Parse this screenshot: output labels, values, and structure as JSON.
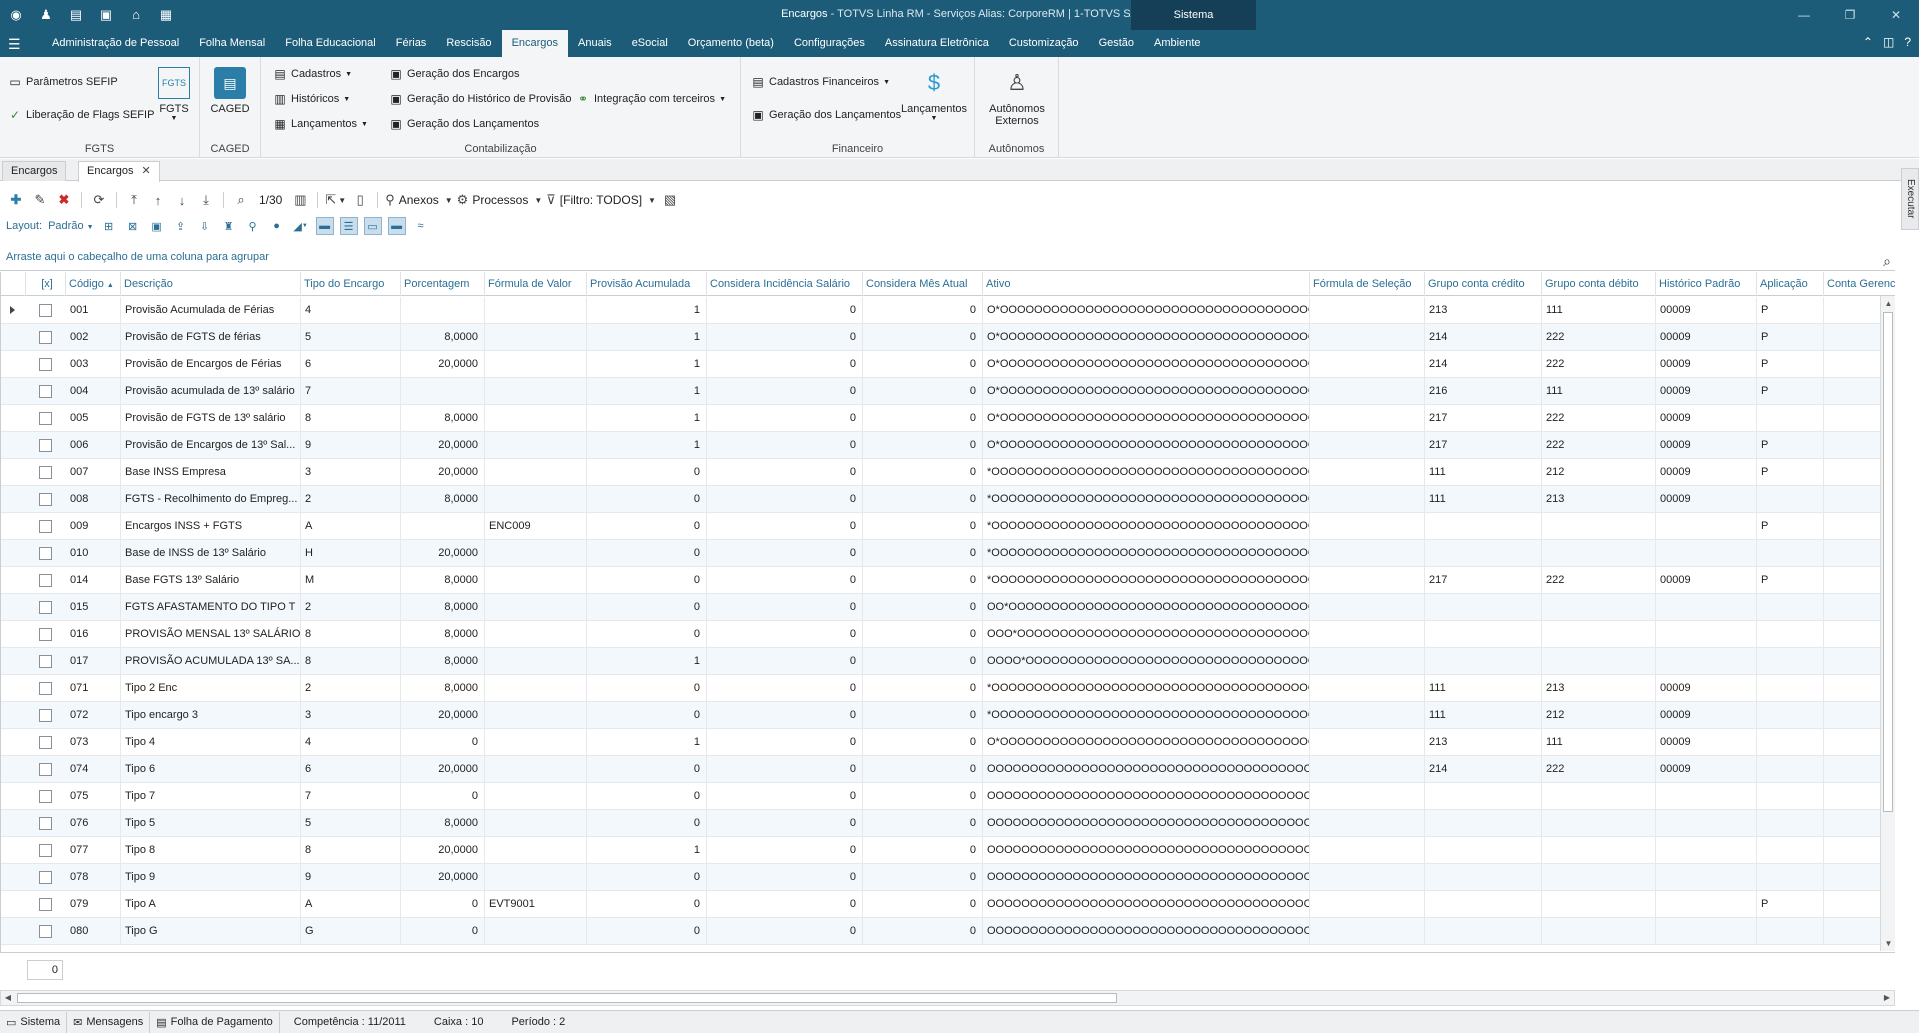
{
  "window": {
    "title_app": "Encargos",
    "title_rest": " - TOTVS Linha RM - Serviços  Alias: CorporeRM | 1-TOTVS SA",
    "context_tab": "Sistema",
    "controls": [
      "—",
      "❐",
      "✕"
    ]
  },
  "menu": {
    "items": [
      "Administração de Pessoal",
      "Folha Mensal",
      "Folha Educacional",
      "Férias",
      "Rescisão",
      "Encargos",
      "Anuais",
      "eSocial",
      "Orçamento (beta)",
      "Configurações",
      "Assinatura Eletrônica",
      "Customização",
      "Gestão",
      "Ambiente"
    ],
    "active": "Encargos"
  },
  "ribbon": {
    "fgts": {
      "label": "FGTS",
      "parametros": "Parâmetros SEFIP",
      "liberacao": "Liberação de Flags SEFIP",
      "fgts_btn": "FGTS",
      "fgts_icon_text": "FGTS"
    },
    "caged": {
      "label": "CAGED",
      "btn": "CAGED"
    },
    "contabilizacao": {
      "label": "Contabilização",
      "cadastros": "Cadastros",
      "historicos": "Históricos",
      "lancamentos": "Lançamentos",
      "geracao_encargos": "Geração dos Encargos",
      "geracao_historico": "Geração do Histórico de Provisão",
      "geracao_lancamentos": "Geração dos Lançamentos",
      "integracao": "Integração com terceiros"
    },
    "financeiro": {
      "label": "Financeiro",
      "cadastros_fin": "Cadastros Financeiros",
      "geracao_lanc": "Geração dos Lançamentos",
      "lancamentos": "Lançamentos"
    },
    "autonomos": {
      "label": "Autônomos",
      "btn_line1": "Autônomos",
      "btn_line2": "Externos"
    }
  },
  "doc_tabs": [
    "Encargos",
    "Encargos"
  ],
  "side_tab": "Executar",
  "toolbar": {
    "pager": "1/30",
    "anexos": "Anexos",
    "processos": "Processos",
    "filtro": "[Filtro: TODOS]"
  },
  "layoutbar": {
    "label": "Layout:",
    "value": "Padrão"
  },
  "group_hint": "Arraste aqui o cabeçalho de uma coluna para agrupar",
  "columns": [
    "[x]",
    "Código",
    "Descrição",
    "Tipo do Encargo",
    "Porcentagem",
    "Fórmula de Valor",
    "Provisão Acumulada",
    "Considera Incidência Salário",
    "Considera Mês Atual",
    "Ativo",
    "Fórmula de Seleção",
    "Grupo conta crédito",
    "Grupo conta débito",
    "Histórico Padrão",
    "Aplicação",
    "Conta Gerenci"
  ],
  "rows": [
    [
      "001",
      "Provisão Acumulada de Férias",
      "4",
      "",
      "",
      "1",
      "0",
      "0",
      "O*OOOOOOOOOOOOOOOOOOOOOOOOOOOOOOOOOOOOOO...",
      "",
      "213",
      "111",
      "00009",
      "P"
    ],
    [
      "002",
      "Provisão de FGTS de férias",
      "5",
      "8,0000",
      "",
      "1",
      "0",
      "0",
      "O*OOOOOOOOOOOOOOOOOOOOOOOOOOOOOOOOOOOOOO...",
      "",
      "214",
      "222",
      "00009",
      "P"
    ],
    [
      "003",
      "Provisão de Encargos de Férias",
      "6",
      "20,0000",
      "",
      "1",
      "0",
      "0",
      "O*OOOOOOOOOOOOOOOOOOOOOOOOOOOOOOOOOOOOOO...",
      "",
      "214",
      "222",
      "00009",
      "P"
    ],
    [
      "004",
      "Provisão acumulada de 13º salário",
      "7",
      "",
      "",
      "1",
      "0",
      "0",
      "O*OOOOOOOOOOOOOOOOOOOOOOOOOOOOOOOOOOOOOO...",
      "",
      "216",
      "111",
      "00009",
      "P"
    ],
    [
      "005",
      "Provisão de FGTS de 13º salário",
      "8",
      "8,0000",
      "",
      "1",
      "0",
      "0",
      "O*OOOOOOOOOOOOOOOOOOOOOOOOOOOOOOOOOOOOOO...",
      "",
      "217",
      "222",
      "00009",
      ""
    ],
    [
      "006",
      "Provisão de Encargos de 13º Sal...",
      "9",
      "20,0000",
      "",
      "1",
      "0",
      "0",
      "O*OOOOOOOOOOOOOOOOOOOOOOOOOOOOOOOOOOOOOO...",
      "",
      "217",
      "222",
      "00009",
      "P"
    ],
    [
      "007",
      "Base INSS Empresa",
      "3",
      "20,0000",
      "",
      "0",
      "0",
      "0",
      "*OOOOOOOOOOOOOOOOOOOOOOOOOOOOOOOOOOOOOOO...",
      "",
      "111",
      "212",
      "00009",
      "P"
    ],
    [
      "008",
      "FGTS - Recolhimento do Empreg...",
      "2",
      "8,0000",
      "",
      "0",
      "0",
      "0",
      "*OOOOOOOOOOOOOOOOOOOOOOOOOOOOOOOOOOOOOOO...",
      "",
      "111",
      "213",
      "00009",
      ""
    ],
    [
      "009",
      "Encargos  INSS + FGTS",
      "A",
      "",
      "ENC009",
      "0",
      "0",
      "0",
      "*OOOOOOOOOOOOOOOOOOOOOOOOOOOOOOOOOOOOOOO...",
      "",
      "",
      "",
      "",
      "P"
    ],
    [
      "010",
      "Base de INSS de 13º Salário",
      "H",
      "20,0000",
      "",
      "0",
      "0",
      "0",
      "*OOOOOOOOOOOOOOOOOOOOOOOOOOOOOOOOOOOOOOO...",
      "",
      "",
      "",
      "",
      ""
    ],
    [
      "014",
      "Base FGTS 13º Salário",
      "M",
      "8,0000",
      "",
      "0",
      "0",
      "0",
      "*OOOOOOOOOOOOOOOOOOOOOOOOOOOOOOOOOOOOOOO...",
      "",
      "217",
      "222",
      "00009",
      "P"
    ],
    [
      "015",
      "FGTS AFASTAMENTO DO TIPO T",
      "2",
      "8,0000",
      "",
      "0",
      "0",
      "0",
      "OO*OOOOOOOOOOOOOOOOOOOOOOOOOOOOOOOOOOOOO...",
      "",
      "",
      "",
      "",
      ""
    ],
    [
      "016",
      "PROVISÃO MENSAL 13º SALÁRIO",
      "8",
      "8,0000",
      "",
      "0",
      "0",
      "0",
      "OOO*OOOOOOOOOOOOOOOOOOOOOOOOOOOOOOOOOOOO...",
      "",
      "",
      "",
      "",
      ""
    ],
    [
      "017",
      "PROVISÃO ACUMULADA 13º SA...",
      "8",
      "8,0000",
      "",
      "1",
      "0",
      "0",
      "OOOO*OOOOOOOOOOOOOOOOOOOOOOOOOOOOOOOOOOO...",
      "",
      "",
      "",
      "",
      ""
    ],
    [
      "071",
      "Tipo 2 Enc",
      "2",
      "8,0000",
      "",
      "0",
      "0",
      "0",
      "*OOOOOOOOOOOOOOOOOOOOOOOOOOOOOOOOOOOOOOO...",
      "",
      "111",
      "213",
      "00009",
      ""
    ],
    [
      "072",
      "Tipo encargo 3",
      "3",
      "20,0000",
      "",
      "0",
      "0",
      "0",
      "*OOOOOOOOOOOOOOOOOOOOOOOOOOOOOOOOOOOOOOO...",
      "",
      "111",
      "212",
      "00009",
      ""
    ],
    [
      "073",
      "Tipo 4",
      "4",
      "0",
      "",
      "1",
      "0",
      "0",
      "O*OOOOOOOOOOOOOOOOOOOOOOOOOOOOOOOOOOOOOO...",
      "",
      "213",
      "111",
      "00009",
      ""
    ],
    [
      "074",
      "Tipo 6",
      "6",
      "20,0000",
      "",
      "0",
      "0",
      "0",
      "OOOOOOOOOOOOOOOOOOOOOOOOOOOOOOOOOOOOOOOO...",
      "",
      "214",
      "222",
      "00009",
      ""
    ],
    [
      "075",
      "Tipo 7",
      "7",
      "0",
      "",
      "0",
      "0",
      "0",
      "OOOOOOOOOOOOOOOOOOOOOOOOOOOOOOOOOOOOOOOO...",
      "",
      "",
      "",
      "",
      ""
    ],
    [
      "076",
      "Tipo 5",
      "5",
      "8,0000",
      "",
      "0",
      "0",
      "0",
      "OOOOOOOOOOOOOOOOOOOOOOOOOOOOOOOOOOOOOOOO...",
      "",
      "",
      "",
      "",
      ""
    ],
    [
      "077",
      "Tipo 8",
      "8",
      "20,0000",
      "",
      "1",
      "0",
      "0",
      "OOOOOOOOOOOOOOOOOOOOOOOOOOOOOOOOOOOOOOOO...",
      "",
      "",
      "",
      "",
      ""
    ],
    [
      "078",
      "Tipo 9",
      "9",
      "20,0000",
      "",
      "0",
      "0",
      "0",
      "OOOOOOOOOOOOOOOOOOOOOOOOOOOOOOOOOOOOOOOO...",
      "",
      "",
      "",
      "",
      ""
    ],
    [
      "079",
      "Tipo A",
      "A",
      "0",
      "EVT9001",
      "0",
      "0",
      "0",
      "OOOOOOOOOOOOOOOOOOOOOOOOOOOOOOOOOOOOOOOO...",
      "",
      "",
      "",
      "",
      "P"
    ],
    [
      "080",
      "Tipo G",
      "G",
      "0",
      "",
      "0",
      "0",
      "0",
      "OOOOOOOOOOOOOOOOOOOOOOOOOOOOOOOOOOOOOOOO...",
      "",
      "",
      "",
      "",
      ""
    ]
  ],
  "footer_count": "0",
  "statusbar": {
    "sistema": "Sistema",
    "mensagens": "Mensagens",
    "folha": "Folha de Pagamento",
    "competencia": "Competência : 11/2011",
    "caixa": "Caixa : 10",
    "periodo": "Período : 2"
  }
}
